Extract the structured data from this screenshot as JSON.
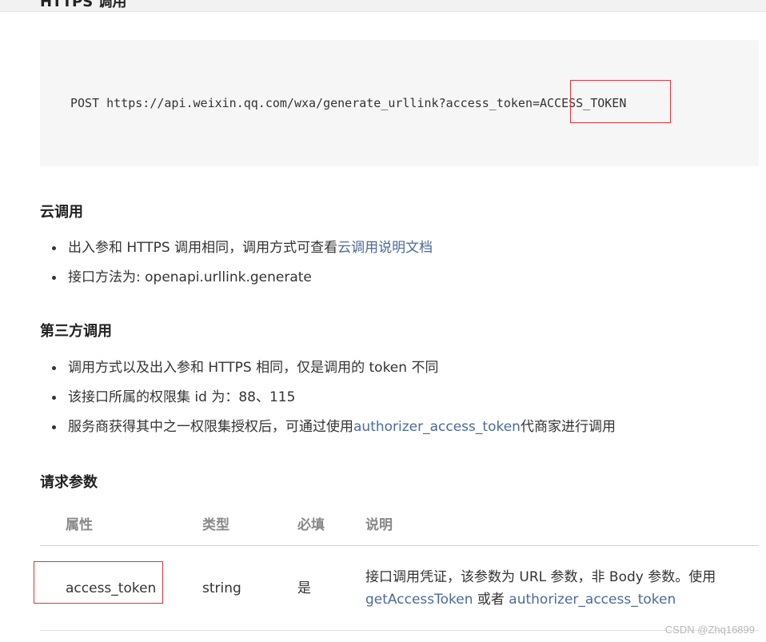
{
  "partial_heading": "HTTPS 调用",
  "code": {
    "prefix": "POST https://api.weixin.qq.com/wxa/generate_urllink?access_token=",
    "token": "ACCESS_TOKEN"
  },
  "cloud": {
    "heading": "云调用",
    "items": [
      {
        "text": "出入参和 HTTPS 调用相同，调用方式可查看",
        "link": "云调用说明文档"
      },
      {
        "text": "接口方法为: openapi.urllink.generate"
      }
    ]
  },
  "third_party": {
    "heading": "第三方调用",
    "items": [
      {
        "text": "调用方式以及出入参和 HTTPS 相同，仅是调用的 token 不同"
      },
      {
        "text": "该接口所属的权限集 id 为：88、115"
      },
      {
        "text": "服务商获得其中之一权限集授权后，可通过使用",
        "link": "authorizer_access_token",
        "suffix": "代商家进行调用"
      }
    ]
  },
  "request_params": {
    "heading": "请求参数",
    "columns": [
      "属性",
      "类型",
      "必填",
      "说明"
    ],
    "rows": [
      {
        "name": "access_token",
        "type": "string",
        "required": "是",
        "desc_line1": "接口调用凭证，该参数为 URL 参数，非 Body 参数。使用",
        "desc_link1": "getAccessToken",
        "desc_mid": " 或者 ",
        "desc_link2": "authorizer_access_token"
      }
    ]
  },
  "watermark": "CSDN @Zhq16899",
  "colors": {
    "link": "#4b6a9b",
    "highlight_border": "#d9363e",
    "code_bg": "#f6f6f6"
  }
}
